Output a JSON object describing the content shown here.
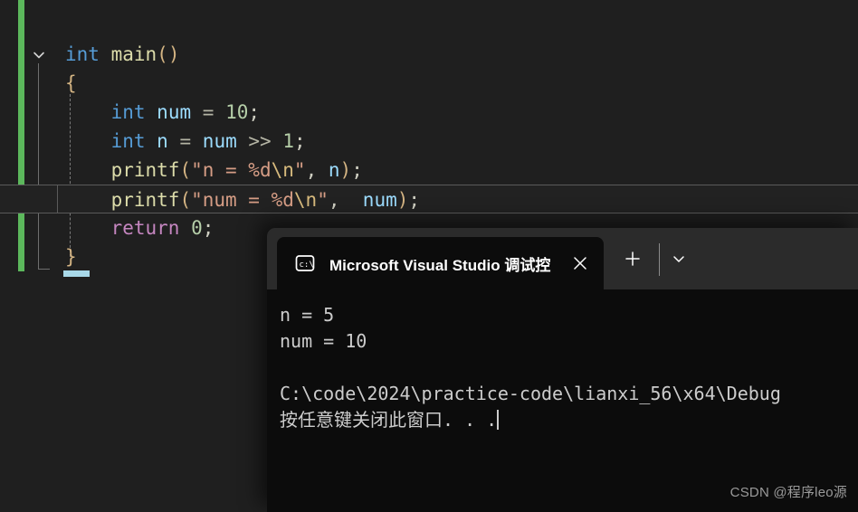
{
  "editor": {
    "background_color": "#1f1f1f",
    "change_bar_color": "#5cb85c",
    "fold_icon": "chevron-down-icon",
    "lines": [
      {
        "id": "line-main-signature",
        "current": false,
        "tokens": [
          {
            "cls": "k-type",
            "text": "int"
          },
          {
            "cls": "plain",
            "text": " "
          },
          {
            "cls": "fn",
            "text": "main"
          },
          {
            "cls": "paren",
            "text": "()"
          }
        ]
      },
      {
        "id": "line-open-brace",
        "current": false,
        "tokens": [
          {
            "cls": "brace",
            "text": "{"
          }
        ]
      },
      {
        "id": "line-decl-num",
        "current": false,
        "tokens": [
          {
            "cls": "plain",
            "text": "    "
          },
          {
            "cls": "k-type",
            "text": "int"
          },
          {
            "cls": "plain",
            "text": " "
          },
          {
            "cls": "var",
            "text": "num"
          },
          {
            "cls": "plain",
            "text": " "
          },
          {
            "cls": "op",
            "text": "="
          },
          {
            "cls": "plain",
            "text": " "
          },
          {
            "cls": "num",
            "text": "10"
          },
          {
            "cls": "punc",
            "text": ";"
          }
        ]
      },
      {
        "id": "line-decl-n",
        "current": false,
        "tokens": [
          {
            "cls": "plain",
            "text": "    "
          },
          {
            "cls": "k-type",
            "text": "int"
          },
          {
            "cls": "plain",
            "text": " "
          },
          {
            "cls": "var",
            "text": "n"
          },
          {
            "cls": "plain",
            "text": " "
          },
          {
            "cls": "op",
            "text": "="
          },
          {
            "cls": "plain",
            "text": " "
          },
          {
            "cls": "var",
            "text": "num"
          },
          {
            "cls": "plain",
            "text": " "
          },
          {
            "cls": "op",
            "text": ">>"
          },
          {
            "cls": "plain",
            "text": " "
          },
          {
            "cls": "num",
            "text": "1"
          },
          {
            "cls": "punc",
            "text": ";"
          }
        ]
      },
      {
        "id": "line-printf-n",
        "current": false,
        "tokens": [
          {
            "cls": "plain",
            "text": "    "
          },
          {
            "cls": "fn",
            "text": "printf"
          },
          {
            "cls": "paren",
            "text": "("
          },
          {
            "cls": "str",
            "text": "\"n = %d"
          },
          {
            "cls": "esc",
            "text": "\\n"
          },
          {
            "cls": "str",
            "text": "\""
          },
          {
            "cls": "punc",
            "text": ","
          },
          {
            "cls": "plain",
            "text": " "
          },
          {
            "cls": "var",
            "text": "n"
          },
          {
            "cls": "paren",
            "text": ")"
          },
          {
            "cls": "punc",
            "text": ";"
          }
        ]
      },
      {
        "id": "line-printf-num",
        "current": true,
        "tokens": [
          {
            "cls": "plain",
            "text": "    "
          },
          {
            "cls": "fn",
            "text": "printf"
          },
          {
            "cls": "paren",
            "text": "("
          },
          {
            "cls": "str",
            "text": "\"num = %d"
          },
          {
            "cls": "esc",
            "text": "\\n"
          },
          {
            "cls": "str",
            "text": "\""
          },
          {
            "cls": "punc",
            "text": ","
          },
          {
            "cls": "plain",
            "text": "  "
          },
          {
            "cls": "var",
            "text": "num"
          },
          {
            "cls": "paren",
            "text": ")"
          },
          {
            "cls": "punc",
            "text": ";"
          }
        ]
      },
      {
        "id": "line-return",
        "current": false,
        "tokens": [
          {
            "cls": "plain",
            "text": "    "
          },
          {
            "cls": "k-ctrl",
            "text": "return"
          },
          {
            "cls": "plain",
            "text": " "
          },
          {
            "cls": "num",
            "text": "0"
          },
          {
            "cls": "punc",
            "text": ";"
          }
        ]
      },
      {
        "id": "line-close-brace",
        "current": false,
        "tokens": [
          {
            "cls": "brace",
            "text": "}"
          }
        ]
      }
    ]
  },
  "terminal": {
    "tab": {
      "icon": "console-cmd-icon",
      "title": "Microsoft Visual Studio 调试控",
      "close_icon": "close-icon"
    },
    "new_tab_icon": "plus-icon",
    "dropdown_icon": "chevron-down-icon",
    "background_color": "#0c0c0c",
    "titlebar_color": "#2b2b2b",
    "output": [
      "n = 5",
      "num = 10",
      "",
      "C:\\code\\2024\\practice-code\\lianxi_56\\x64\\Debug",
      "按任意键关闭此窗口. . ."
    ]
  },
  "watermark": {
    "text": "CSDN @程序leo源"
  }
}
